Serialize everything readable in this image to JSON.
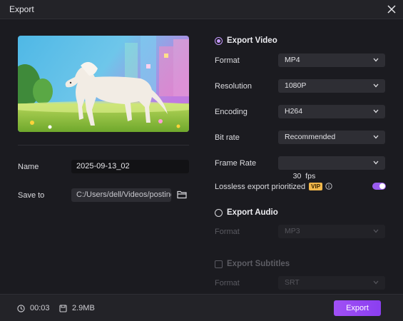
{
  "window": {
    "title": "Export"
  },
  "left": {
    "name_label": "Name",
    "name_value": "2025-09-13_02",
    "save_label": "Save to",
    "save_path": "C:/Users/dell/Videos/posting"
  },
  "video": {
    "section_label": "Export Video",
    "rows": [
      {
        "label": "Format",
        "value": "MP4"
      },
      {
        "label": "Resolution",
        "value": "1080P"
      },
      {
        "label": "Encoding",
        "value": "H264"
      },
      {
        "label": "Bit rate",
        "value": "Recommended"
      },
      {
        "label": "Frame Rate",
        "value": "30  fps"
      }
    ],
    "lossless_label": "Lossless export prioritized",
    "vip_badge": "VIP"
  },
  "audio": {
    "section_label": "Export Audio",
    "format_label": "Format",
    "format_value": "MP3"
  },
  "subtitles": {
    "section_label": "Export Subtitles",
    "format_label": "Format",
    "format_value": "SRT"
  },
  "footer": {
    "duration": "00:03",
    "size": "2.9MB",
    "export_label": "Export"
  },
  "colors": {
    "accent": "#9a5cf0",
    "vip": "#f2b84b"
  }
}
